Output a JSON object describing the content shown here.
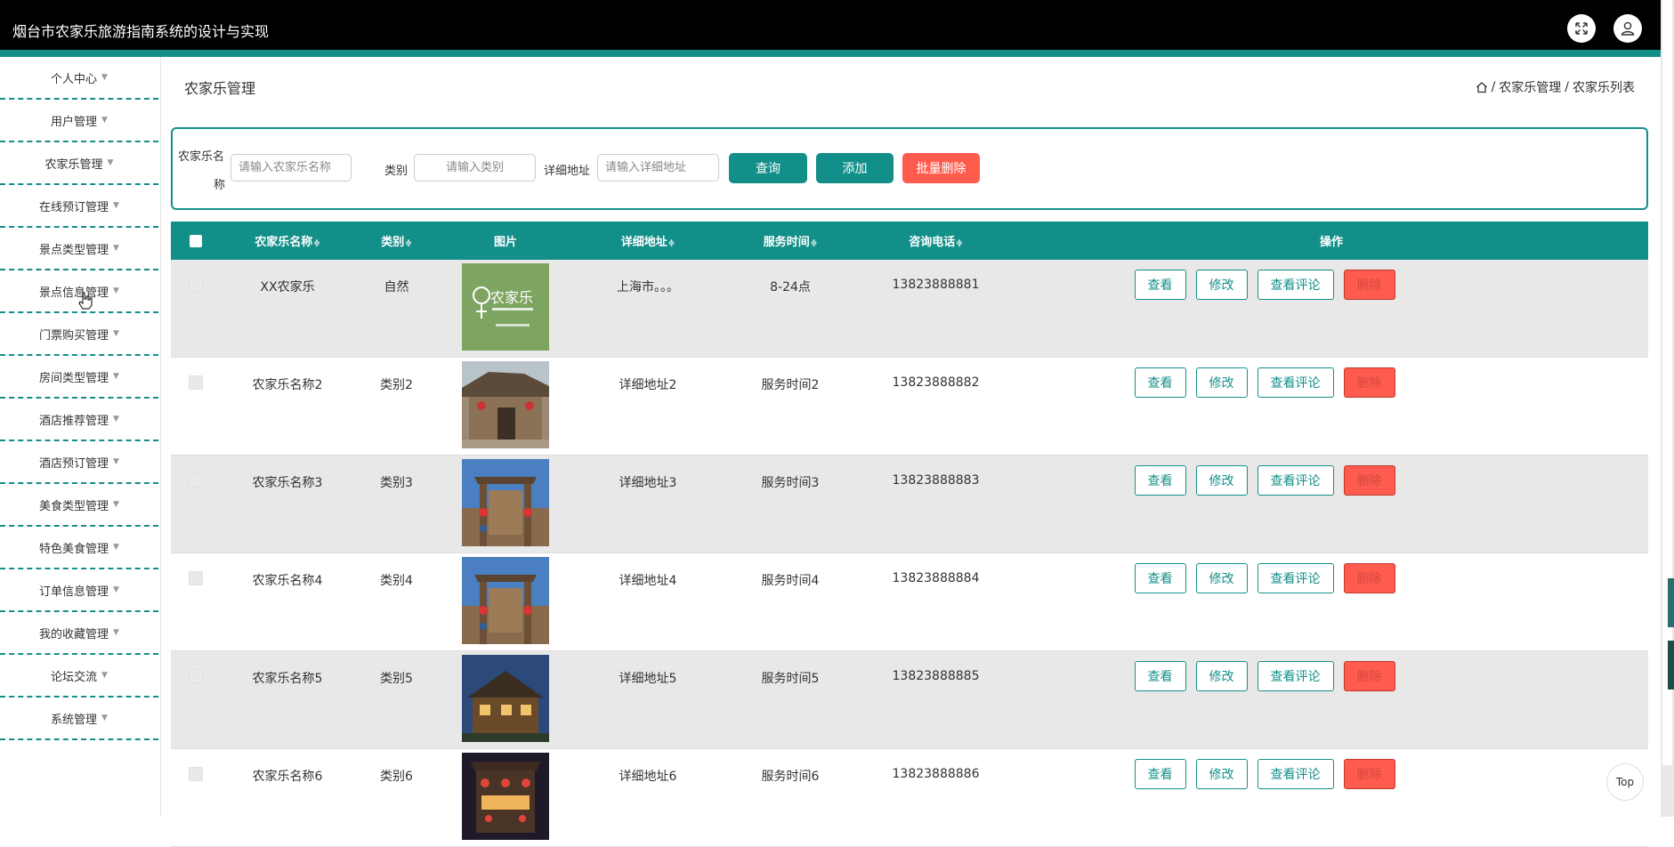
{
  "header": {
    "title": "烟台市农家乐旅游指南系统的设计与实现",
    "fullscreen_icon": "expand-icon",
    "user_icon": "user-icon"
  },
  "sidebar": {
    "items": [
      {
        "label": "个人中心"
      },
      {
        "label": "用户管理"
      },
      {
        "label": "农家乐管理"
      },
      {
        "label": "在线预订管理"
      },
      {
        "label": "景点类型管理"
      },
      {
        "label": "景点信息管理"
      },
      {
        "label": "门票购买管理"
      },
      {
        "label": "房间类型管理"
      },
      {
        "label": "酒店推荐管理"
      },
      {
        "label": "酒店预订管理"
      },
      {
        "label": "美食类型管理"
      },
      {
        "label": "特色美食管理"
      },
      {
        "label": "订单信息管理"
      },
      {
        "label": "我的收藏管理"
      },
      {
        "label": "论坛交流"
      },
      {
        "label": "系统管理"
      }
    ]
  },
  "page": {
    "title": "农家乐管理",
    "breadcrumb": {
      "sep": "/",
      "level1": "农家乐管理",
      "level2": "农家乐列表",
      "home_icon": "home-icon"
    }
  },
  "search": {
    "name_label_line1": "农家乐名",
    "name_label_line2": "称",
    "name_placeholder": "请输入农家乐名称",
    "category_label": "类别",
    "category_placeholder": "请输入类别",
    "address_label": "详细地址",
    "address_placeholder": "请输入详细地址",
    "query_button": "查询",
    "add_button": "添加",
    "batch_delete_button": "批量删除"
  },
  "table": {
    "headers": {
      "name": "农家乐名称",
      "category": "类别",
      "image": "图片",
      "address": "详细地址",
      "service_time": "服务时间",
      "phone": "咨询电话",
      "actions": "操作"
    },
    "sort_icon": "≑",
    "action_labels": {
      "view": "查看",
      "edit": "修改",
      "view_comments": "查看评论",
      "delete": "删除"
    },
    "rows": [
      {
        "name": "XX农家乐",
        "category": "自然",
        "address": "上海市。。。",
        "service_time": "8-24点",
        "phone": "13823888881",
        "image": "farm-logo"
      },
      {
        "name": "农家乐名称2",
        "category": "类别2",
        "address": "详细地址2",
        "service_time": "服务时间2",
        "phone": "13823888882",
        "image": "village-house"
      },
      {
        "name": "农家乐名称3",
        "category": "类别3",
        "address": "详细地址3",
        "service_time": "服务时间3",
        "phone": "13823888883",
        "image": "gate-lanterns"
      },
      {
        "name": "农家乐名称4",
        "category": "类别4",
        "address": "详细地址4",
        "service_time": "服务时间4",
        "phone": "13823888884",
        "image": "gate-lanterns"
      },
      {
        "name": "农家乐名称5",
        "category": "类别5",
        "address": "详细地址5",
        "service_time": "服务时间5",
        "phone": "13823888885",
        "image": "night-house"
      },
      {
        "name": "农家乐名称6",
        "category": "类别6",
        "address": "详细地址6",
        "service_time": "服务时间6",
        "phone": "13823888886",
        "image": "night-street"
      }
    ]
  },
  "back_to_top": "Top",
  "colors": {
    "primary": "#138f8a",
    "danger": "#ff5c4f",
    "header_bg": "#000000"
  }
}
